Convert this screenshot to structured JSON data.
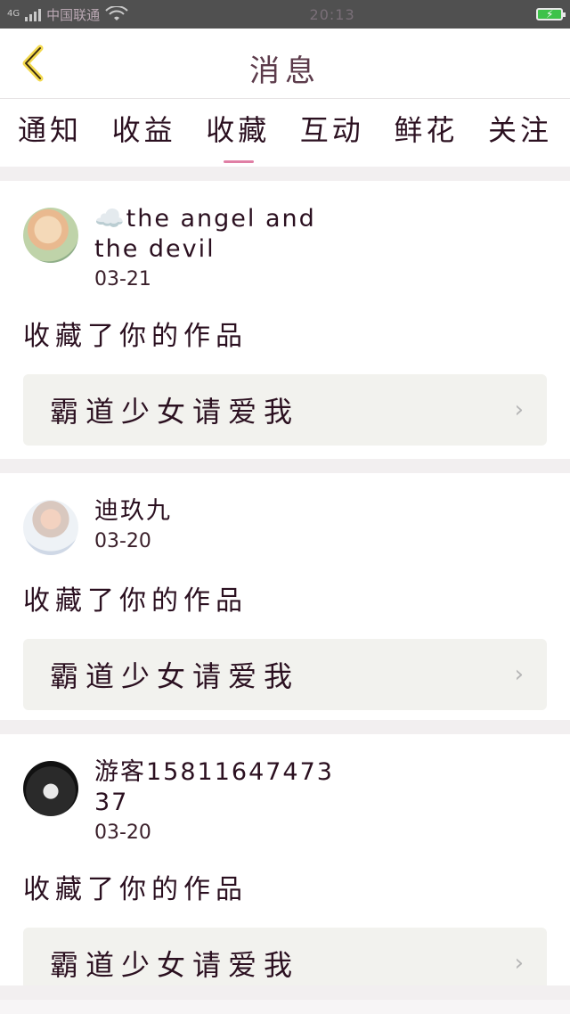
{
  "status_bar": {
    "network": "4G",
    "carrier": "中国联通",
    "time": "20:13"
  },
  "header": {
    "title": "消息"
  },
  "tabs": [
    {
      "label": "通知"
    },
    {
      "label": "收益"
    },
    {
      "label": "收藏",
      "active": true
    },
    {
      "label": "互动"
    },
    {
      "label": "鲜花"
    },
    {
      "label": "关注"
    }
  ],
  "messages": [
    {
      "user": "☁️the angel and the devil",
      "date": "03-21",
      "action": "收藏了你的作品",
      "work_title": "霸道少女请爱我"
    },
    {
      "user": "迪玖九",
      "date": "03-20",
      "action": "收藏了你的作品",
      "work_title": "霸道少女请爱我"
    },
    {
      "user": "游客15811647473 37",
      "date": "03-20",
      "action": "收藏了你的作品",
      "work_title": "霸道少女请爱我"
    }
  ],
  "colors": {
    "accent": "#e07fa5",
    "card_inner": "#f2f2ee",
    "status_bar": "#505050",
    "battery": "#3ec24a"
  }
}
